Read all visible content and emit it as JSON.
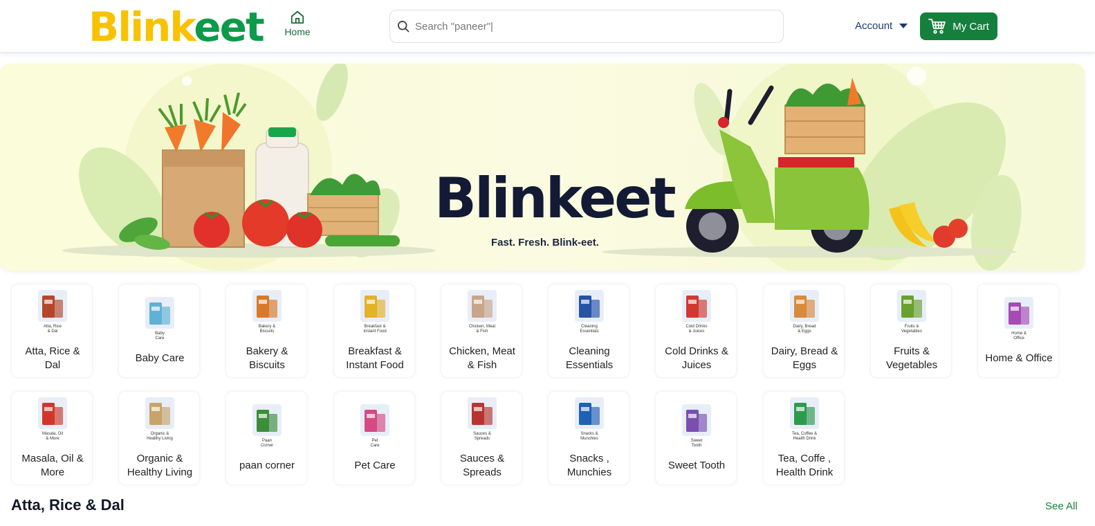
{
  "header": {
    "logo_part1": "Blink",
    "logo_part2": "eet",
    "home_label": "Home",
    "search_placeholder": "Search \"paneer\"|",
    "account_label": "Account",
    "cart_label": "My Cart"
  },
  "banner": {
    "title": "Blinkeet",
    "tagline": "Fast. Fresh. Blink-eet."
  },
  "categories": [
    {
      "label": "Atta, Rice & Dal",
      "mini": [
        "Atta, Rice",
        "& Dal"
      ],
      "color": "#b5462b"
    },
    {
      "label": "Baby Care",
      "mini": [
        "Baby",
        "Care"
      ],
      "color": "#5fb2d6"
    },
    {
      "label": "Bakery & Biscuits",
      "mini": [
        "Bakery &",
        "Biscuits"
      ],
      "color": "#d9792a"
    },
    {
      "label": "Breakfast & Instant Food",
      "mini": [
        "Breakfast &",
        "Instant Food"
      ],
      "color": "#e5b128"
    },
    {
      "label": "Chicken, Meat & Fish",
      "mini": [
        "Chicken, Meat",
        "& Fish"
      ],
      "color": "#c9a58c"
    },
    {
      "label": "Cleaning Essentials",
      "mini": [
        "Cleaning",
        "Essentials"
      ],
      "color": "#2553a8"
    },
    {
      "label": "Cold Drinks & Juices",
      "mini": [
        "Cold Drinks",
        "& Juices"
      ],
      "color": "#d0392f"
    },
    {
      "label": "Dairy, Bread & Eggs",
      "mini": [
        "Dairy, Bread",
        "& Eggs"
      ],
      "color": "#d98a3a"
    },
    {
      "label": "Fruits & Vegetables",
      "mini": [
        "Fruits &",
        "Vegetables"
      ],
      "color": "#6aa02e"
    },
    {
      "label": "Home & Office",
      "mini": [
        "Home &",
        "Office"
      ],
      "color": "#a64bb5"
    },
    {
      "label": "Masala, Oil & More",
      "mini": [
        "Masala, Oil",
        "& More"
      ],
      "color": "#d0372a"
    },
    {
      "label": "Organic & Healthy Living",
      "mini": [
        "Organic &",
        "Healthy Living"
      ],
      "color": "#c8a36a"
    },
    {
      "label": "paan corner",
      "mini": [
        "Paan",
        "Corner"
      ],
      "color": "#3c8f3a"
    },
    {
      "label": "Pet Care",
      "mini": [
        "Pet",
        "Care"
      ],
      "color": "#d54a85"
    },
    {
      "label": "Sauces & Spreads",
      "mini": [
        "Sauces &",
        "Spreads"
      ],
      "color": "#b8352f"
    },
    {
      "label": "Snacks , Munchies",
      "mini": [
        "Snacks &",
        "Munchies"
      ],
      "color": "#2060b5"
    },
    {
      "label": "Sweet Tooth",
      "mini": [
        "Sweet",
        "Tooth"
      ],
      "color": "#7a4fb0"
    },
    {
      "label": "Tea, Coffe , Health Drink",
      "mini": [
        "Tea, Coffee &",
        "Health Drink"
      ],
      "color": "#2e9a4d"
    }
  ],
  "section": {
    "title": "Atta, Rice & Dal",
    "see_all": "See All"
  }
}
